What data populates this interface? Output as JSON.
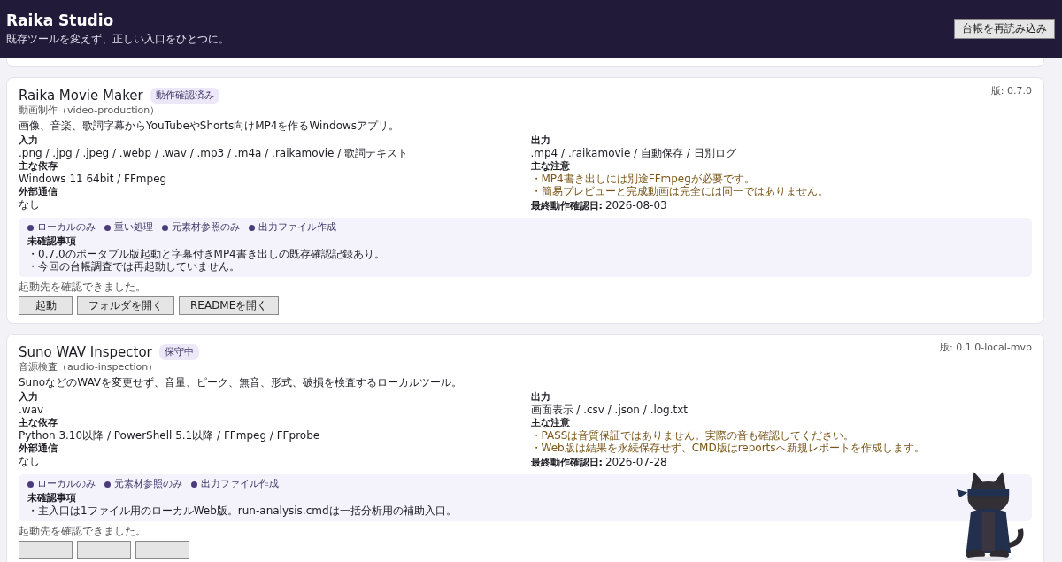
{
  "header": {
    "title": "Raika Studio",
    "subtitle": "既存ツールを変えず、正しい入口をひとつに。",
    "reload_button": "台帳を再読み込み"
  },
  "tools": [
    {
      "name": "Raika Movie Maker",
      "badge": "動作確認済み",
      "category": "動画制作（video-production）",
      "version": "版: 0.7.0",
      "description": "画像、音楽、歌詞字幕からYouTubeやShorts向けMP4を作るWindowsアプリ。",
      "left_fields": [
        {
          "label": "入力",
          "value": ".png / .jpg / .jpeg / .webp / .wav / .mp3 / .m4a / .raikamovie / 歌詞テキスト"
        },
        {
          "label": "主な依存",
          "value": "Windows 11 64bit / FFmpeg"
        },
        {
          "label": "外部通信",
          "value": "なし"
        }
      ],
      "output": {
        "label": "出力",
        "value": ".mp4 / .raikamovie / 自動保存 / 日別ログ"
      },
      "notes": {
        "label": "主な注意",
        "items": [
          "・MP4書き出しには別途FFmpegが必要です。",
          "・簡易プレビューと完成動画は完全には同一ではありません。"
        ]
      },
      "last_checked": {
        "label": "最終動作確認日:",
        "value": "2026-08-03"
      },
      "tags": [
        "ローカルのみ",
        "重い処理",
        "元素材参照のみ",
        "出力ファイル作成"
      ],
      "unconfirmed": {
        "label": "未確認事項",
        "items": [
          "・0.7.0のポータブル版起動と字幕付きMP4書き出しの既存確認記録あり。",
          "・今回の台帳調査では再起動していません。"
        ]
      },
      "status": "起動先を確認できました。",
      "buttons": [
        {
          "kind": "labeled",
          "label": "起動"
        },
        {
          "kind": "labeled",
          "label": "フォルダを開く"
        },
        {
          "kind": "labeled",
          "label": "READMEを開く"
        }
      ]
    },
    {
      "name": "Suno WAV Inspector",
      "badge": "保守中",
      "category": "音源検査（audio-inspection）",
      "version": "版: 0.1.0-local-mvp",
      "description": "SunoなどのWAVを変更せず、音量、ピーク、無音、形式、破損を検査するローカルツール。",
      "left_fields": [
        {
          "label": "入力",
          "value": ".wav"
        },
        {
          "label": "主な依存",
          "value": "Python 3.10以降 / PowerShell 5.1以降 / FFmpeg / FFprobe"
        },
        {
          "label": "外部通信",
          "value": "なし"
        }
      ],
      "output": {
        "label": "出力",
        "value": "画面表示 / .csv / .json / .log.txt"
      },
      "notes": {
        "label": "主な注意",
        "items": [
          "・PASSは音質保証ではありません。実際の音も確認してください。",
          "・Web版は結果を永続保存せず、CMD版はreportsへ新規レポートを作成します。"
        ]
      },
      "last_checked": {
        "label": "最終動作確認日:",
        "value": "2026-07-28"
      },
      "tags": [
        "ローカルのみ",
        "元素材参照のみ",
        "出力ファイル作成"
      ],
      "unconfirmed": {
        "label": "未確認事項",
        "items": [
          "・主入口は1ファイル用のローカルWeb版。run-analysis.cmdは一括分析用の補助入口。"
        ]
      },
      "status": "起動先を確認できました。",
      "buttons": [
        {
          "kind": "cut"
        },
        {
          "kind": "cut"
        },
        {
          "kind": "cut"
        }
      ]
    }
  ]
}
